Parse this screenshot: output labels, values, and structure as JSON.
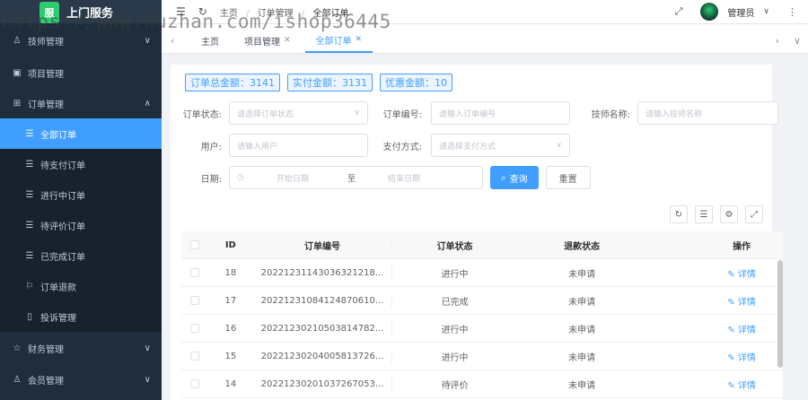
{
  "app": {
    "logo_text": "上门服务",
    "logo_mark": "服"
  },
  "sidebar": {
    "items": [
      {
        "label": "技师管理",
        "icon": "technician-icon",
        "chevron": "∨"
      },
      {
        "label": "项目管理",
        "icon": "project-icon"
      },
      {
        "label": "订单管理",
        "icon": "order-icon",
        "chevron": "∧"
      },
      {
        "label": "订单退款",
        "icon": "refund-icon"
      },
      {
        "label": "投诉管理",
        "icon": "complaint-icon"
      },
      {
        "label": "财务管理",
        "icon": "finance-icon",
        "chevron": "∨"
      },
      {
        "label": "会员管理",
        "icon": "member-icon",
        "chevron": "∨"
      }
    ],
    "order_sub": [
      {
        "label": "全部订单",
        "active": true
      },
      {
        "label": "待支付订单"
      },
      {
        "label": "进行中订单"
      },
      {
        "label": "待评价订单"
      },
      {
        "label": "已完成订单"
      }
    ]
  },
  "header": {
    "breadcrumb": [
      "主页",
      "订单管理",
      "全部订单"
    ],
    "user": "管理员"
  },
  "tabs": [
    {
      "label": "主页"
    },
    {
      "label": "项目管理",
      "closable": true
    },
    {
      "label": "全部订单",
      "closable": true,
      "active": true
    }
  ],
  "amounts": {
    "total": "订单总金额：3141",
    "paid": "实付金额：3131",
    "discount": "优惠金额：10"
  },
  "filters": {
    "order_status_label": "订单状态:",
    "order_status_placeholder": "请选择订单状态",
    "order_no_label": "订单编号:",
    "order_no_placeholder": "请输入订单编号",
    "tech_name_label": "技师名称:",
    "tech_name_placeholder": "请输入技师名称",
    "user_label": "用户:",
    "user_placeholder": "请输入用户",
    "pay_method_label": "支付方式:",
    "pay_method_placeholder": "请选择支付方式",
    "date_label": "日期:",
    "date_start": "开始日期",
    "date_to": "至",
    "date_end": "结束日期",
    "query_button": "查询",
    "reset_button": "重置"
  },
  "table": {
    "headers": [
      "ID",
      "订单编号",
      "订单状态",
      "退款状态",
      "操作"
    ],
    "rows": [
      {
        "id": "18",
        "order_no": "20221231143036321218...",
        "status": "进行中",
        "refund": "未申请",
        "action": "详情"
      },
      {
        "id": "17",
        "order_no": "20221231084124870610...",
        "status": "已完成",
        "refund": "未申请",
        "action": "详情"
      },
      {
        "id": "16",
        "order_no": "20221230210503814782...",
        "status": "进行中",
        "refund": "未申请",
        "action": "详情"
      },
      {
        "id": "15",
        "order_no": "20221230204005813726...",
        "status": "进行中",
        "refund": "未申请",
        "action": "详情"
      },
      {
        "id": "14",
        "order_no": "20221230201037267053...",
        "status": "待评价",
        "refund": "未申请",
        "action": "详情"
      }
    ]
  },
  "watermark": "https://www.huzhan.com/ishop36445",
  "colors": {
    "primary": "#409eff",
    "sidebar_bg": "#1f2d3d"
  }
}
